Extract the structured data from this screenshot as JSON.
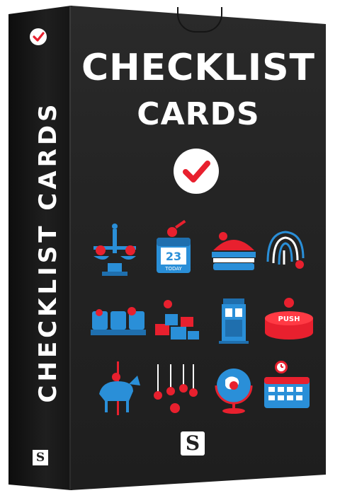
{
  "product": {
    "title_line1": "CHECKLIST",
    "title_line2": "CARDS",
    "spine_title": "CHECKLIST CARDS",
    "publisher_mark": "S"
  },
  "colors": {
    "box": "#242424",
    "text": "#ffffff",
    "accent_red": "#e8202e",
    "accent_blue": "#2a8fd8"
  },
  "icons": [
    {
      "name": "balance-scale-icon"
    },
    {
      "name": "calendar-today-icon",
      "day": "23",
      "label": "TODAY"
    },
    {
      "name": "burger-icon"
    },
    {
      "name": "fingerprint-icon"
    },
    {
      "name": "cinema-seats-icon"
    },
    {
      "name": "building-blocks-icon"
    },
    {
      "name": "phone-booth-icon"
    },
    {
      "name": "push-button-icon",
      "label": "PUSH"
    },
    {
      "name": "carousel-horse-icon"
    },
    {
      "name": "target-practice-icon"
    },
    {
      "name": "globe-icon"
    },
    {
      "name": "calendar-clock-icon"
    }
  ]
}
